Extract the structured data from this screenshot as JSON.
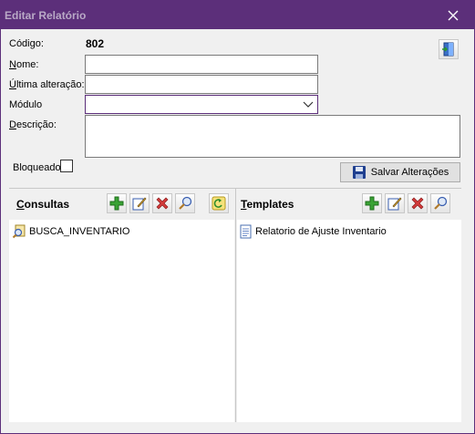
{
  "window": {
    "title": "Editar Relatório",
    "close_glyph": "✕"
  },
  "form": {
    "codigo_label": "Código:",
    "codigo_value": "802",
    "nome_label_u": "N",
    "nome_label_rest": "ome:",
    "nome_value": "",
    "ultima_label_u": "Ú",
    "ultima_label_rest": "ltima alteração:",
    "ultima_value": "",
    "modulo_label": "Módulo",
    "modulo_value": "",
    "descricao_label_u": "D",
    "descricao_label_rest": "escrição:",
    "descricao_value": "",
    "bloqueado_label": "Bloqueado",
    "bloqueado_checked": false,
    "save_label": "Salvar Alterações"
  },
  "consultas": {
    "title_u": "C",
    "title_rest": "onsultas",
    "items": [
      {
        "label": "BUSCA_INVENTARIO",
        "icon": "query-icon"
      }
    ]
  },
  "templates": {
    "title_u": "T",
    "title_rest": "emplates",
    "items": [
      {
        "label": "Relatorio de Ajuste Inventario",
        "icon": "document-icon"
      }
    ]
  },
  "colors": {
    "titlebar": "#5c2f7a",
    "accent_green": "#3aa335",
    "accent_red": "#d33a3a"
  }
}
